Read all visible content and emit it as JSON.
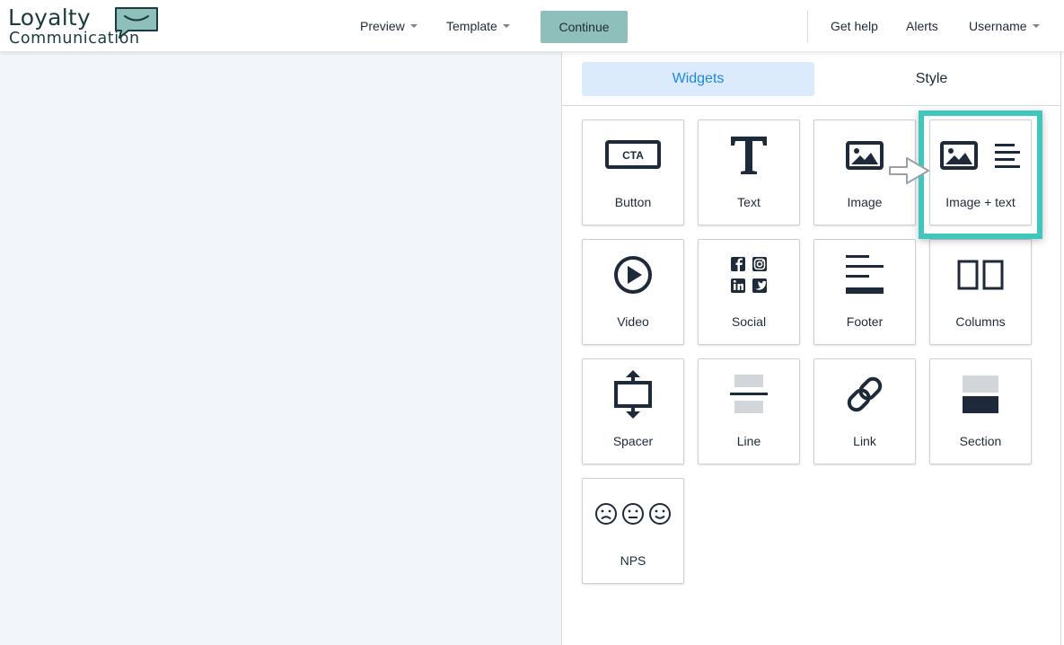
{
  "header": {
    "logo": {
      "line1": "Loyalty",
      "line2": "Communication"
    },
    "nav": {
      "preview": "Preview",
      "template": "Template",
      "continue": "Continue",
      "get_help": "Get help",
      "alerts": "Alerts",
      "username": "Username"
    }
  },
  "panel": {
    "tabs": {
      "widgets": "Widgets",
      "style": "Style"
    },
    "widgets": [
      {
        "label": "Button",
        "icon": "cta-icon",
        "icon_text": "CTA"
      },
      {
        "label": "Text",
        "icon": "text-icon"
      },
      {
        "label": "Image",
        "icon": "image-icon"
      },
      {
        "label": "Image + text",
        "icon": "image-text-icon"
      },
      {
        "label": "Video",
        "icon": "play-icon"
      },
      {
        "label": "Social",
        "icon": "social-icons"
      },
      {
        "label": "Footer",
        "icon": "footer-icon"
      },
      {
        "label": "Columns",
        "icon": "columns-icon"
      },
      {
        "label": "Spacer",
        "icon": "spacer-icon"
      },
      {
        "label": "Line",
        "icon": "line-icon"
      },
      {
        "label": "Link",
        "icon": "link-icon"
      },
      {
        "label": "Section",
        "icon": "section-icon"
      },
      {
        "label": "NPS",
        "icon": "nps-faces-icon"
      }
    ]
  },
  "colors": {
    "accent": "#1e88e5",
    "continue_bg": "#8fbfba",
    "highlight": "#3fc7bd",
    "icon_dark": "#1e2a3a"
  }
}
